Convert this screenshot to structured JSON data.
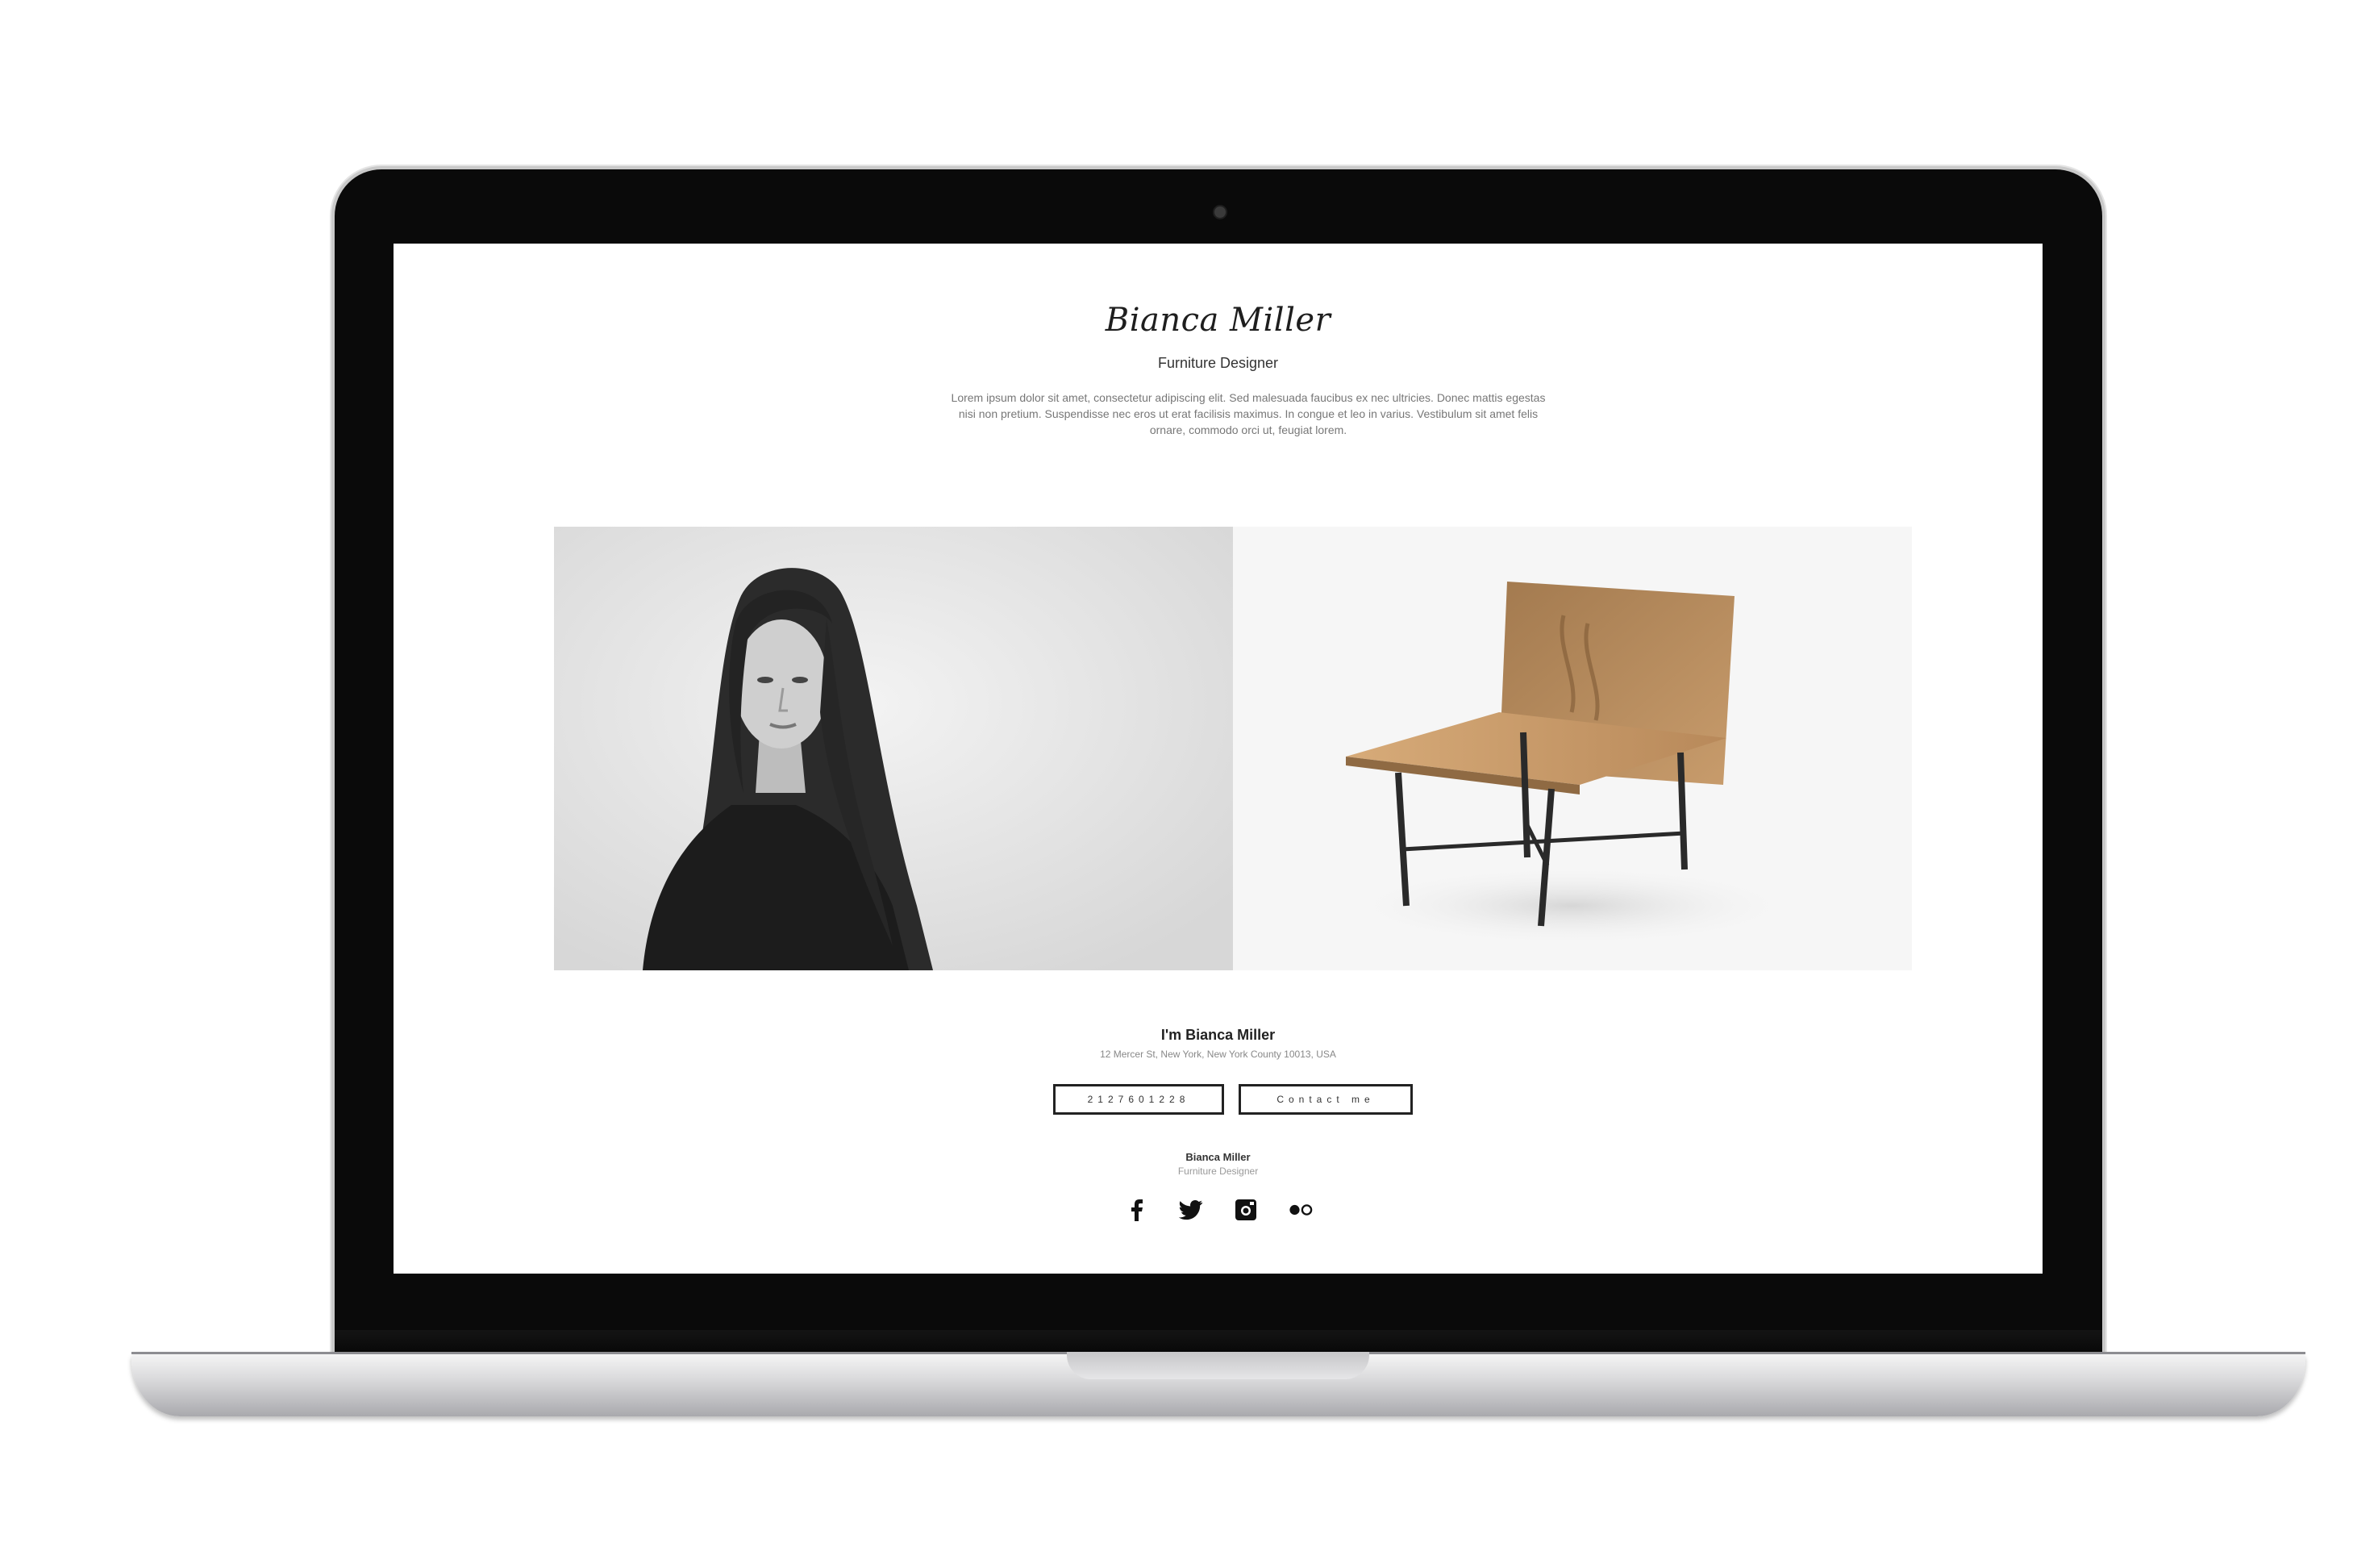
{
  "profile": {
    "name": "Bianca Miller",
    "role": "Furniture Designer",
    "intro": "Lorem ipsum dolor sit amet, consectetur adipiscing elit. Sed malesuada faucibus ex nec ultricies. Donec mattis egestas nisi non pretium. Suspendisse nec eros ut erat facilisis maximus. In congue et leo in varius. Vestibulum sit amet felis ornare, commodo orci ut, feugiat lorem."
  },
  "gallery": {
    "left_image": "portrait-photo",
    "right_image": "wooden-chair-photo"
  },
  "about": {
    "title": "I'm Bianca Miller",
    "address": "12 Mercer St, New York, New York County 10013, USA"
  },
  "buttons": {
    "phone_label": "2127601228",
    "contact_label": "Contact me"
  },
  "footer": {
    "name": "Bianca Miller",
    "role": "Furniture Designer",
    "social_icons": [
      "facebook-icon",
      "twitter-icon",
      "instagram-icon",
      "flickr-icon"
    ]
  },
  "colors": {
    "text_dark": "#1e1e1e",
    "text_muted": "#777777",
    "laptop_bezel": "#0a0a0a",
    "laptop_base": "#d8d8da"
  }
}
